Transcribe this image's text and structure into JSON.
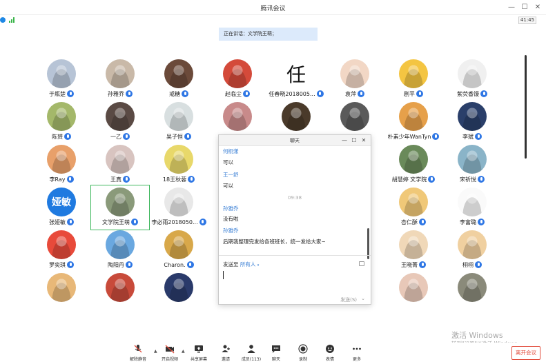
{
  "window": {
    "title": "腾讯会议",
    "timer": "41:45"
  },
  "speaking_banner": "正在讲话：文学院王萌；",
  "participants": [
    {
      "name": "于瓶楚",
      "avatar_color": "#b7c4d6"
    },
    {
      "name": "孙雅乔",
      "avatar_color": "#c9b9a8"
    },
    {
      "name": "戒糖",
      "avatar_color": "#6b4a3a"
    },
    {
      "name": "赵临尘",
      "avatar_color": "#d44a3a"
    },
    {
      "name": "任春晓2018005...",
      "avatar_color": "#ffffff",
      "avatar_glyph": "任"
    },
    {
      "name": "袁萍",
      "avatar_color": "#f2d7c5"
    },
    {
      "name": "剧平",
      "avatar_color": "#f4c542"
    },
    {
      "name": "紫荧香馒",
      "avatar_color": "#f0f0f0"
    },
    {
      "name": "陈赟",
      "avatar_color": "#a4b86a"
    },
    {
      "name": "一乙",
      "avatar_color": "#5a4a44"
    },
    {
      "name": "吴子恒",
      "avatar_color": "#d8dfe0"
    },
    {
      "name": "",
      "avatar_color": "#c88a8a"
    },
    {
      "name": "",
      "avatar_color": "#4a3a2a"
    },
    {
      "name": "",
      "avatar_color": "#5a5a5a"
    },
    {
      "name": "朴素少年WanTyn",
      "avatar_color": "#e6a04a"
    },
    {
      "name": "李斌",
      "avatar_color": "#2a3f6a"
    },
    {
      "name": "李Ray",
      "avatar_color": "#e8a06a"
    },
    {
      "name": "王真",
      "avatar_color": "#d8c4c0"
    },
    {
      "name": "18王秋蓉",
      "avatar_color": "#e8d86a"
    },
    {
      "name": "胡慧婷 文学院",
      "avatar_color": "#6a8a5a"
    },
    {
      "name": "宋祈悦",
      "avatar_color": "#8ab4c8"
    },
    {
      "name": "张娅敏",
      "avatar_color": "#1f7ae0",
      "avatar_text": "娅敏"
    },
    {
      "name": "文学院王萌",
      "avatar_color": "#8a9a7a"
    },
    {
      "name": "李必雨2018050...",
      "avatar_color": "#e8e8e8"
    },
    {
      "name": "杏仁酥",
      "avatar_color": "#f0c878"
    },
    {
      "name": "李富璐",
      "avatar_color": "#fafafa"
    },
    {
      "name": "罗奕琪",
      "avatar_color": "#e84a3a"
    },
    {
      "name": "陶阳丹",
      "avatar_color": "#6aa8e0"
    },
    {
      "name": "Charon.",
      "avatar_color": "#d8a84a"
    },
    {
      "name": "王晓菁",
      "avatar_color": "#f0d8b8"
    },
    {
      "name": "栩栩",
      "avatar_color": "#f0d0a0"
    },
    {
      "name": "",
      "avatar_color": "#e8b878"
    },
    {
      "name": "",
      "avatar_color": "#c84a3a"
    },
    {
      "name": "",
      "avatar_color": "#2a3a6a"
    },
    {
      "name": "",
      "avatar_color": "#e8c8b8"
    },
    {
      "name": "",
      "avatar_color": "#8a8a7a"
    }
  ],
  "chat": {
    "title": "聊天",
    "messages": [
      {
        "sender": "何栩漾",
        "text": "可以"
      },
      {
        "sender": "王一舒",
        "text": "可以"
      },
      {
        "sender": "孙雅乔",
        "text": "没有啦"
      },
      {
        "sender": "孙雅乔",
        "text": "后期我整理完发给各班班长，统一发给大家~"
      }
    ],
    "time_divider": "09:38",
    "send_to_label": "发送至",
    "send_to_target": "所有人",
    "input_value": "",
    "send_label": "发送(S)"
  },
  "toolbar": {
    "items": [
      {
        "label": "解除静音",
        "icon": "mic-muted-icon"
      },
      {
        "label": "开启视频",
        "icon": "video-off-icon"
      },
      {
        "label": "共享屏幕",
        "icon": "screen-share-icon"
      },
      {
        "label": "邀请",
        "icon": "invite-icon"
      },
      {
        "label": "成员(113)",
        "icon": "members-icon"
      },
      {
        "label": "聊天",
        "icon": "chat-icon"
      },
      {
        "label": "录制",
        "icon": "record-icon"
      },
      {
        "label": "表情",
        "icon": "emoji-icon"
      },
      {
        "label": "更多",
        "icon": "more-icon"
      }
    ],
    "leave_label": "离开会议"
  },
  "watermark": {
    "line1": "激活 Windows",
    "line2": "转到\"设置\"以激活 Windows。"
  },
  "colors": {
    "accent": "#2f77e5",
    "highlight": "#3cb65b",
    "danger": "#e24b3b"
  }
}
